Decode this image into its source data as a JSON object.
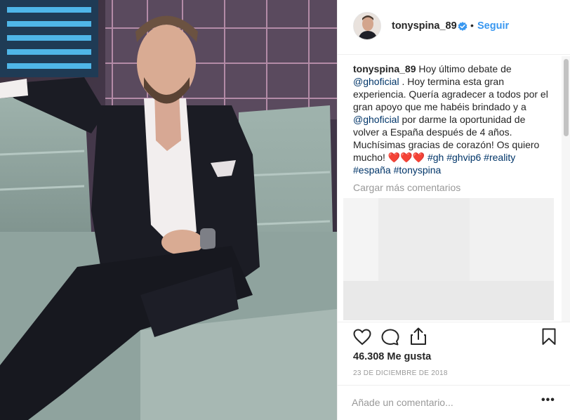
{
  "post": {
    "username": "tonyspina_89",
    "follow_label": "Seguir",
    "separator": "•",
    "caption_username": "tonyspina_89",
    "caption_parts": {
      "p1": " Hoy último debate de ",
      "mention1": "@ghoficial",
      "p2": " . Hoy termina esta gran experiencia. Quería agradecer a todos por el gran apoyo que me habéis brindado y a ",
      "mention2": "@ghoficial",
      "p3": " por darme la oportunidad de volver a España después de 4 años. Muchísimas gracias de corazón! Os quiero mucho! ❤️❤️❤️ ",
      "tag1": "#gh",
      "tag2": "#ghvip6",
      "tag3": "#reality",
      "tag4": "#españa",
      "tag5": "#tonyspina"
    },
    "load_more_label": "Cargar más comentarios",
    "likes": "46.308 Me gusta",
    "date": "23 DE DICIEMBRE DE 2018",
    "comment_placeholder": "Añade un comentario...",
    "more_label": "•••"
  },
  "icons": {
    "like": "heart-icon",
    "comment": "comment-icon",
    "share": "share-icon",
    "save": "bookmark-icon",
    "verified": "verified-badge-icon"
  },
  "colors": {
    "link": "#3897f0",
    "hashtag": "#003569",
    "muted": "#999999",
    "text": "#262626"
  }
}
